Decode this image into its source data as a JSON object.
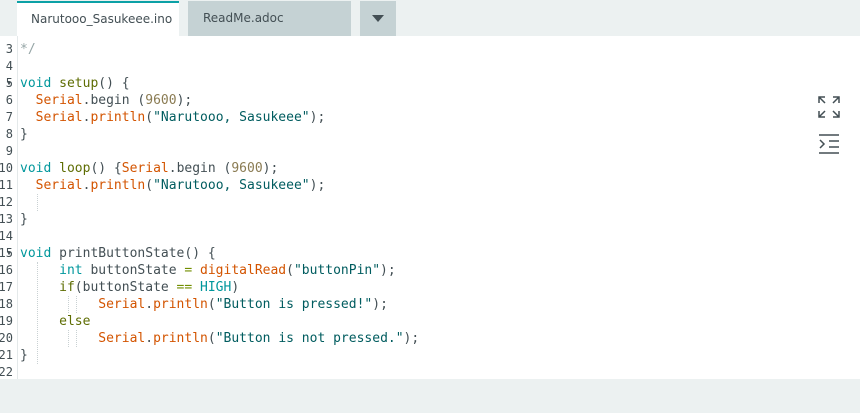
{
  "tabs": {
    "active": "Narutooo_Sasukeee.ino",
    "second": "ReadMe.adoc"
  },
  "icons": {
    "tab_menu": "chevron-down-icon",
    "fullscreen": "expand-icon",
    "indent": "indent-icon"
  },
  "colors": {
    "accent": "#0ca1a6",
    "keyword": "#00979c",
    "function": "#5e6d03",
    "class": "#d35400",
    "string": "#005c5f",
    "number": "#8a7b52"
  },
  "editor": {
    "lines": [
      {
        "n": "3",
        "fold": "",
        "parts": [
          {
            "t": "*/",
            "c": "cm"
          }
        ]
      },
      {
        "n": "4",
        "fold": "",
        "parts": []
      },
      {
        "n": "5",
        "fold": "▾",
        "parts": [
          {
            "t": "void",
            "c": "ty"
          },
          {
            "t": " "
          },
          {
            "t": "setup",
            "c": "fn"
          },
          {
            "t": "() {"
          }
        ]
      },
      {
        "n": "6",
        "fold": "",
        "parts": [
          {
            "t": "  "
          },
          {
            "t": "Serial",
            "c": "cls"
          },
          {
            "t": "."
          },
          {
            "t": "begin",
            "c": ""
          },
          {
            "t": " ("
          },
          {
            "t": "9600",
            "c": "num"
          },
          {
            "t": ");"
          }
        ]
      },
      {
        "n": "7",
        "fold": "",
        "parts": [
          {
            "t": "  "
          },
          {
            "t": "Serial",
            "c": "cls"
          },
          {
            "t": "."
          },
          {
            "t": "println",
            "c": "cls"
          },
          {
            "t": "("
          },
          {
            "t": "\"Narutooo, Sasukeee\"",
            "c": "str"
          },
          {
            "t": ");"
          }
        ]
      },
      {
        "n": "8",
        "fold": "",
        "parts": [
          {
            "t": "}"
          }
        ]
      },
      {
        "n": "9",
        "fold": "",
        "parts": []
      },
      {
        "n": "10",
        "fold": "",
        "parts": [
          {
            "t": "void",
            "c": "ty"
          },
          {
            "t": " "
          },
          {
            "t": "loop",
            "c": "fn"
          },
          {
            "t": "() {"
          },
          {
            "t": "Serial",
            "c": "cls"
          },
          {
            "t": "."
          },
          {
            "t": "begin"
          },
          {
            "t": " ("
          },
          {
            "t": "9600",
            "c": "num"
          },
          {
            "t": ");"
          }
        ]
      },
      {
        "n": "11",
        "fold": "",
        "parts": [
          {
            "t": "  "
          },
          {
            "t": "Serial",
            "c": "cls"
          },
          {
            "t": "."
          },
          {
            "t": "println",
            "c": "cls"
          },
          {
            "t": "("
          },
          {
            "t": "\"Narutooo, Sasukeee\"",
            "c": "str"
          },
          {
            "t": ");"
          }
        ]
      },
      {
        "n": "12",
        "fold": "",
        "parts": []
      },
      {
        "n": "13",
        "fold": "",
        "parts": [
          {
            "t": "}"
          }
        ]
      },
      {
        "n": "14",
        "fold": "",
        "parts": []
      },
      {
        "n": "15",
        "fold": "▾",
        "parts": [
          {
            "t": "void",
            "c": "ty"
          },
          {
            "t": " printButtonState() {"
          }
        ]
      },
      {
        "n": "16",
        "fold": "",
        "parts": [
          {
            "t": "     "
          },
          {
            "t": "int",
            "c": "ty"
          },
          {
            "t": " buttonState "
          },
          {
            "t": "=",
            "c": "op"
          },
          {
            "t": " "
          },
          {
            "t": "digitalRead",
            "c": "cls"
          },
          {
            "t": "("
          },
          {
            "t": "\"buttonPin\"",
            "c": "str"
          },
          {
            "t": ");"
          }
        ]
      },
      {
        "n": "17",
        "fold": "",
        "parts": [
          {
            "t": "     "
          },
          {
            "t": "if",
            "c": "fn"
          },
          {
            "t": "(buttonState "
          },
          {
            "t": "==",
            "c": "op"
          },
          {
            "t": " "
          },
          {
            "t": "HIGH",
            "c": "cst"
          },
          {
            "t": ")"
          }
        ]
      },
      {
        "n": "18",
        "fold": "",
        "parts": [
          {
            "t": "          "
          },
          {
            "t": "Serial",
            "c": "cls"
          },
          {
            "t": "."
          },
          {
            "t": "println",
            "c": "cls"
          },
          {
            "t": "("
          },
          {
            "t": "\"Button is pressed!\"",
            "c": "str"
          },
          {
            "t": ");"
          }
        ]
      },
      {
        "n": "19",
        "fold": "",
        "parts": [
          {
            "t": "     "
          },
          {
            "t": "else",
            "c": "fn"
          }
        ]
      },
      {
        "n": "20",
        "fold": "",
        "parts": [
          {
            "t": "          "
          },
          {
            "t": "Serial",
            "c": "cls"
          },
          {
            "t": "."
          },
          {
            "t": "println",
            "c": "cls"
          },
          {
            "t": "("
          },
          {
            "t": "\"Button is not pressed.\"",
            "c": "str"
          },
          {
            "t": ");"
          }
        ]
      },
      {
        "n": "21",
        "fold": "",
        "parts": [
          {
            "t": "}"
          }
        ]
      },
      {
        "n": "22",
        "fold": "",
        "parts": []
      }
    ]
  }
}
